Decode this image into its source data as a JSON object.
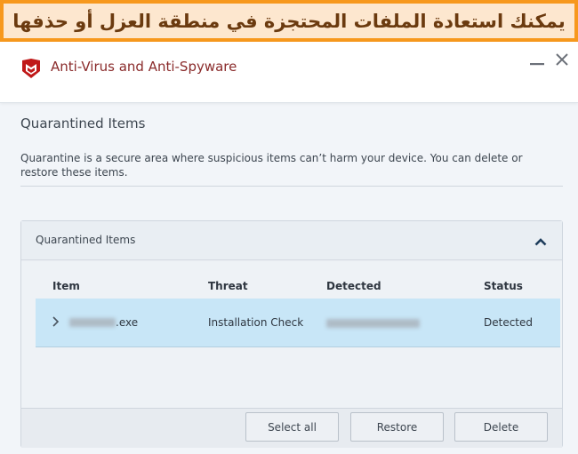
{
  "banner": {
    "text": "يمكنك استعادة الملفات المحتجزة في منطقة العزل أو حذفها"
  },
  "window": {
    "app_title": "Anti-Virus and Anti-Spyware",
    "logo_icon": "mcafee-shield-icon",
    "minimize_icon": "minimize-icon",
    "close_icon": "close-icon",
    "brand_color": "#c01818"
  },
  "page": {
    "title": "Quarantined Items",
    "description": "Quarantine is a secure area where suspicious items can’t harm your device. You can delete or restore these items."
  },
  "panel": {
    "title": "Quarantined Items",
    "collapse_icon": "chevron-up-icon",
    "columns": [
      "Item",
      "Threat",
      "Detected",
      "Status"
    ],
    "rows": [
      {
        "item_suffix": ".exe",
        "threat": "Installation Check",
        "status": "Detected",
        "selected": true
      }
    ],
    "buttons": {
      "select_all": "Select all",
      "restore": "Restore",
      "delete": "Delete"
    }
  }
}
